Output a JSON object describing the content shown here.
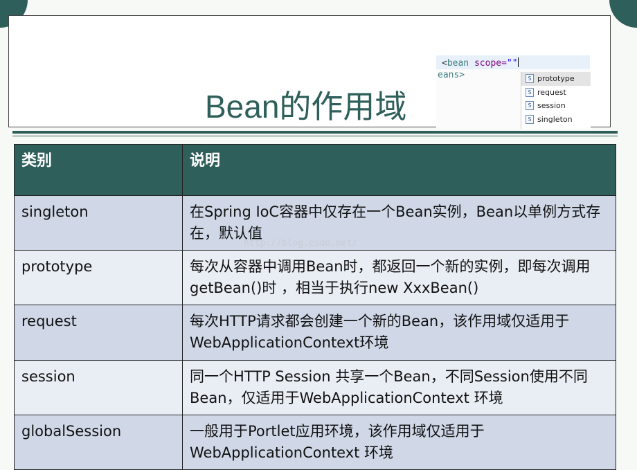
{
  "slide": {
    "title": "Bean的作用域",
    "watermark": "http://blog.csdn.net/",
    "colors": {
      "accent": "#2f5f5a",
      "row_odd": "#d0d8e8",
      "row_even": "#e9edf4"
    }
  },
  "ide_snippet": {
    "lt": "<",
    "tag": "bean",
    "attr": " scope=",
    "value": "\"\"",
    "line2": "eans>",
    "options": [
      "prototype",
      "request",
      "session",
      "singleton"
    ],
    "option_icon": "S"
  },
  "table": {
    "headers": [
      "类别",
      "说明"
    ],
    "rows": [
      {
        "scope": "singleton",
        "desc": "在Spring IoC容器中仅存在一个Bean实例，Bean以单例方式存在，默认值"
      },
      {
        "scope": "prototype",
        "desc": "每次从容器中调用Bean时，都返回一个新的实例，即每次调用getBean()时 ，相当于执行new XxxBean()"
      },
      {
        "scope": "request",
        "desc": "每次HTTP请求都会创建一个新的Bean，该作用域仅适用于WebApplicationContext环境"
      },
      {
        "scope": "session",
        "desc": "同一个HTTP Session 共享一个Bean，不同Session使用不同Bean，仅适用于WebApplicationContext 环境"
      },
      {
        "scope": "globalSession",
        "desc": "一般用于Portlet应用环境，该作用域仅适用于WebApplicationContext 环境"
      }
    ]
  }
}
